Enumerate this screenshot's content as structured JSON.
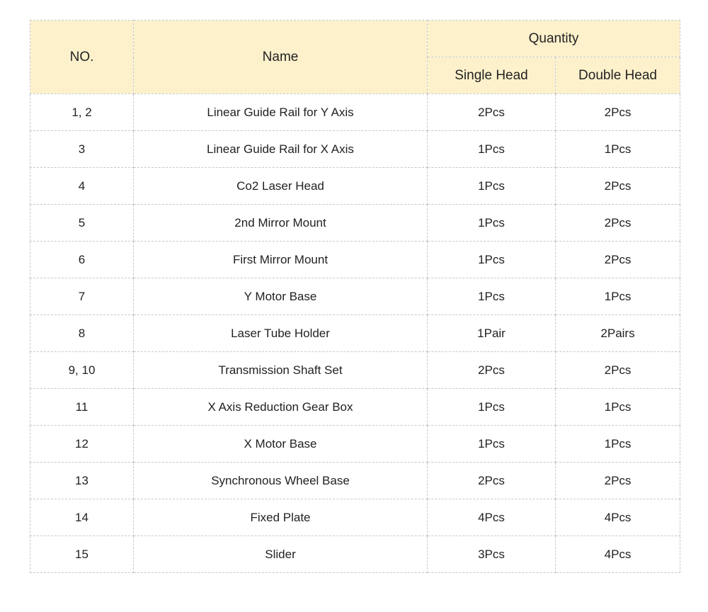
{
  "table": {
    "headers": {
      "no": "NO.",
      "name": "Name",
      "quantity": "Quantity",
      "single": "Single Head",
      "double": "Double Head"
    },
    "rows": [
      {
        "no": "1, 2",
        "name": "Linear Guide Rail for Y Axis",
        "single": "2Pcs",
        "double": "2Pcs"
      },
      {
        "no": "3",
        "name": "Linear Guide Rail for X Axis",
        "single": "1Pcs",
        "double": "1Pcs"
      },
      {
        "no": "4",
        "name": "Co2 Laser Head",
        "single": "1Pcs",
        "double": "2Pcs"
      },
      {
        "no": "5",
        "name": "2nd Mirror Mount",
        "single": "1Pcs",
        "double": "2Pcs"
      },
      {
        "no": "6",
        "name": "First Mirror Mount",
        "single": "1Pcs",
        "double": "2Pcs"
      },
      {
        "no": "7",
        "name": "Y Motor Base",
        "single": "1Pcs",
        "double": "1Pcs"
      },
      {
        "no": "8",
        "name": "Laser Tube Holder",
        "single": "1Pair",
        "double": "2Pairs"
      },
      {
        "no": "9, 10",
        "name": "Transmission Shaft Set",
        "single": "2Pcs",
        "double": "2Pcs"
      },
      {
        "no": "11",
        "name": "X Axis Reduction Gear Box",
        "single": "1Pcs",
        "double": "1Pcs"
      },
      {
        "no": "12",
        "name": "X Motor Base",
        "single": "1Pcs",
        "double": "1Pcs"
      },
      {
        "no": "13",
        "name": "Synchronous Wheel Base",
        "single": "2Pcs",
        "double": "2Pcs"
      },
      {
        "no": "14",
        "name": "Fixed Plate",
        "single": "4Pcs",
        "double": "4Pcs"
      },
      {
        "no": "15",
        "name": "Slider",
        "single": "3Pcs",
        "double": "4Pcs"
      }
    ]
  },
  "colors": {
    "header_background": "#fdf1cc",
    "border": "#c8c8c8",
    "text": "#222222"
  }
}
